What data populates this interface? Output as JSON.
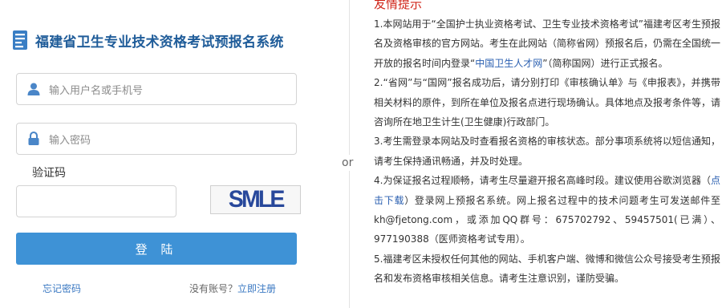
{
  "brand": {
    "title": "福建省卫生专业技术资格考试预报名系统"
  },
  "login": {
    "username_placeholder": "输入用户名或手机号",
    "password_placeholder": "输入密码",
    "captcha_label": "验证码",
    "captcha_text": "SMLE",
    "login_button": "登 陆",
    "forgot_password": "忘记密码",
    "no_account": "没有账号？",
    "register_link": "立即注册"
  },
  "divider": {
    "or_label": "or"
  },
  "tips": {
    "title": "友情提示",
    "items": [
      {
        "pre": "1.本网站用于“全国护士执业资格考试、卫生专业技术资格考试”福建考区考生预报名及资格审核的官方网站。考生在此网站（简称省网）预报名后，仍需在全国统一开放的报名时间内登录“",
        "link": "中国卫生人才网",
        "post": "”（简称国网）进行正式报名。"
      },
      {
        "pre": "2.“省网”与“国网”报名成功后，请分别打印《审核确认单》与《申报表》，并携带相关材料的原件，到所在单位及报名点进行现场确认。具体地点及报考条件等，请咨询所在地卫生计生(卫生健康)行政部门。",
        "link": "",
        "post": ""
      },
      {
        "pre": "3.考生需登录本网站及时查看报名资格的审核状态。部分事项系统将以短信通知，请考生保持通讯畅通，并及时处理。",
        "link": "",
        "post": ""
      },
      {
        "pre": "4.为保证报名过程顺畅，请考生尽量避开报名高峰时段。建议使用谷歌浏览器（",
        "link": "点击下载",
        "post": "）登录网上预报名系统。网上报名过程中的技术问题考生可发送邮件至kh@fjetong.com，或添加QQ群号：675702792、59457501(已满）、977190388（医师资格考试专用）。"
      },
      {
        "pre": "5.福建考区未授权任何其他的网站、手机客户端、微博和微信公众号接受考生预报名和发布资格审核相关信息。请考生注意识别，谨防受骗。",
        "link": "",
        "post": ""
      }
    ]
  },
  "colors": {
    "brand_blue": "#1f5c99",
    "button_blue": "#3e92d6",
    "link_blue": "#3a78c2",
    "tip_red": "#d0261a",
    "icon_blue": "#4a86c8"
  }
}
